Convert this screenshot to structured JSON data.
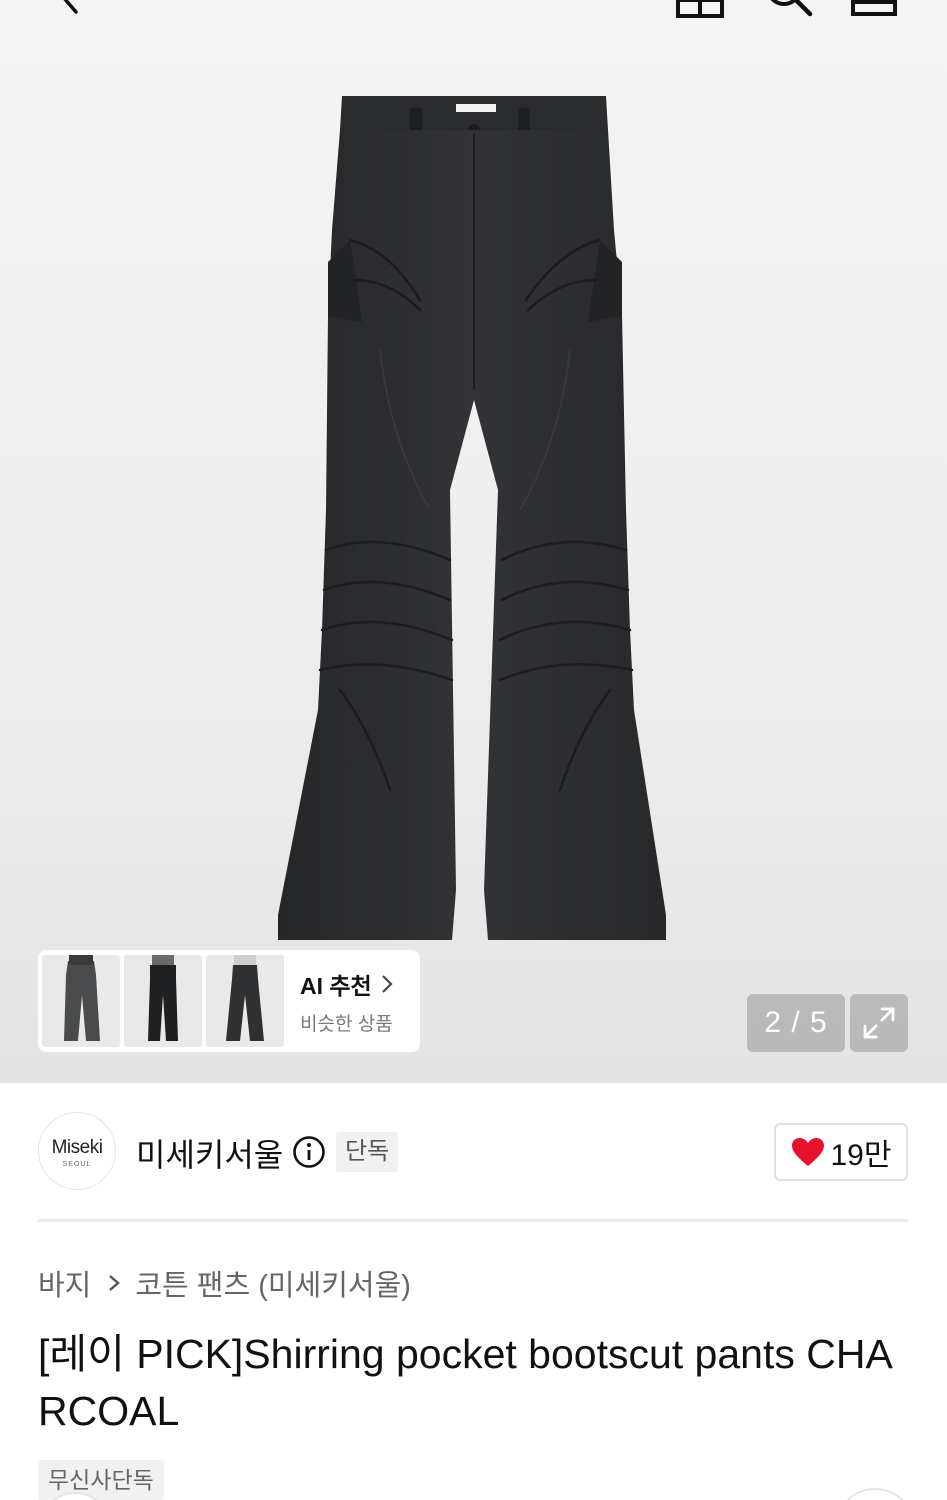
{
  "gallery": {
    "ai_recommend": {
      "title": "AI 추천",
      "subtitle": "비슷한 상품"
    },
    "pager": "2 / 5"
  },
  "brand": {
    "logo_main": "Miseki",
    "logo_sub": "SEOUL",
    "name": "미세키서울",
    "badge": "단독",
    "like_count": "19만"
  },
  "breadcrumb": {
    "category": "바지",
    "subcategory": "코튼 팬츠 (미세키서울)"
  },
  "product": {
    "title": "[레이 PICK]Shirring pocket bootscut pants CHARCOAL",
    "tag": "무신사단독"
  },
  "icons": {
    "back": "back-arrow-icon",
    "home": "home-icon",
    "search": "search-icon",
    "cart": "shopping-bag-icon",
    "expand": "expand-icon",
    "info": "info-icon",
    "heart": "heart-icon",
    "chevron": "chevron-right-icon"
  },
  "colors": {
    "heart": "#e8112d",
    "pants": "#2e2f31"
  }
}
